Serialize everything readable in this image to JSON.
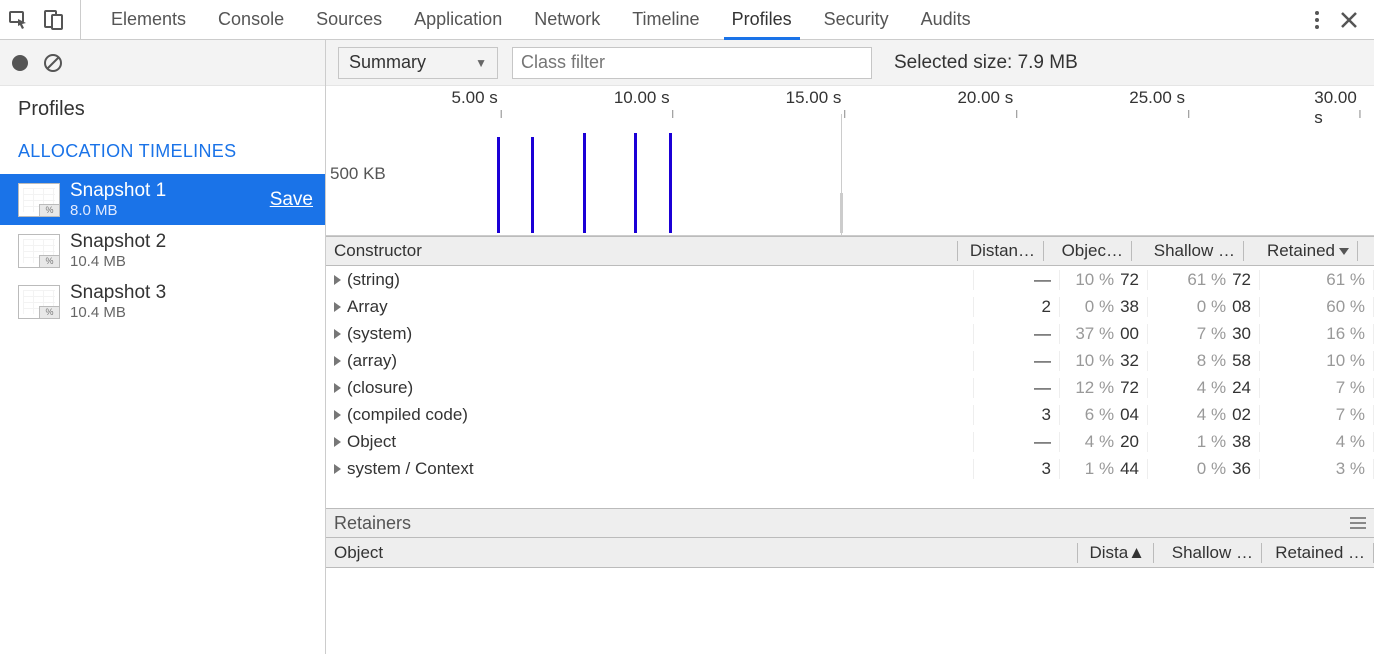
{
  "tabs": [
    "Elements",
    "Console",
    "Sources",
    "Application",
    "Network",
    "Timeline",
    "Profiles",
    "Security",
    "Audits"
  ],
  "active_tab_index": 6,
  "sidebar": {
    "title": "Profiles",
    "section": "ALLOCATION TIMELINES",
    "snapshots": [
      {
        "name": "Snapshot 1",
        "size": "8.0 MB",
        "selected": true,
        "save": "Save"
      },
      {
        "name": "Snapshot 2",
        "size": "10.4 MB",
        "selected": false
      },
      {
        "name": "Snapshot 3",
        "size": "10.4 MB",
        "selected": false
      }
    ]
  },
  "toolbar": {
    "view": "Summary",
    "filter_placeholder": "Class filter",
    "selected_size": "Selected size: 7.9 MB"
  },
  "chart_data": {
    "type": "bar",
    "x_unit": "s",
    "x_ticks": [
      5.0,
      10.0,
      15.0,
      20.0,
      25.0,
      30.0
    ],
    "tick_labels": [
      "5.00 s",
      "10.00 s",
      "15.00 s",
      "20.00 s",
      "25.00 s",
      "30.00 s"
    ],
    "y_label": "500 KB",
    "ylim_kb": [
      0,
      500
    ],
    "bars": [
      {
        "t": 5.0,
        "height_kb": 480
      },
      {
        "t": 6.0,
        "height_kb": 480
      },
      {
        "t": 7.5,
        "height_kb": 500
      },
      {
        "t": 9.0,
        "height_kb": 500
      },
      {
        "t": 10.0,
        "height_kb": 500
      },
      {
        "t": 15.0,
        "height_kb": 200,
        "faded": true
      }
    ]
  },
  "table": {
    "headers": {
      "constructor": "Constructor",
      "distance": "Distan…",
      "objects": "Objec…",
      "shallow": "Shallow …",
      "retained": "Retained"
    },
    "rows": [
      {
        "name": "(string)",
        "distance": "—",
        "obj_pct": "10 %",
        "obj_frag": "72",
        "sh_pct": "61 %",
        "sh_frag": "72",
        "rt_pct": "61 %"
      },
      {
        "name": "Array",
        "distance": "2",
        "obj_pct": "0 %",
        "obj_frag": "38",
        "sh_pct": "0 %",
        "sh_frag": "08",
        "rt_pct": "60 %"
      },
      {
        "name": "(system)",
        "distance": "—",
        "obj_pct": "37 %",
        "obj_frag": "00",
        "sh_pct": "7 %",
        "sh_frag": "30",
        "rt_pct": "16 %"
      },
      {
        "name": "(array)",
        "distance": "—",
        "obj_pct": "10 %",
        "obj_frag": "32",
        "sh_pct": "8 %",
        "sh_frag": "58",
        "rt_pct": "10 %"
      },
      {
        "name": "(closure)",
        "distance": "—",
        "obj_pct": "12 %",
        "obj_frag": "72",
        "sh_pct": "4 %",
        "sh_frag": "24",
        "rt_pct": "7 %"
      },
      {
        "name": "(compiled code)",
        "distance": "3",
        "obj_pct": "6 %",
        "obj_frag": "04",
        "sh_pct": "4 %",
        "sh_frag": "02",
        "rt_pct": "7 %"
      },
      {
        "name": "Object",
        "distance": "—",
        "obj_pct": "4 %",
        "obj_frag": "20",
        "sh_pct": "1 %",
        "sh_frag": "38",
        "rt_pct": "4 %"
      },
      {
        "name": "system / Context",
        "distance": "3",
        "obj_pct": "1 %",
        "obj_frag": "44",
        "sh_pct": "0 %",
        "sh_frag": "36",
        "rt_pct": "3 %"
      }
    ]
  },
  "retainers": {
    "title": "Retainers",
    "headers": {
      "object": "Object",
      "distance": "Dista",
      "shallow": "Shallow …",
      "retained": "Retained …"
    }
  }
}
